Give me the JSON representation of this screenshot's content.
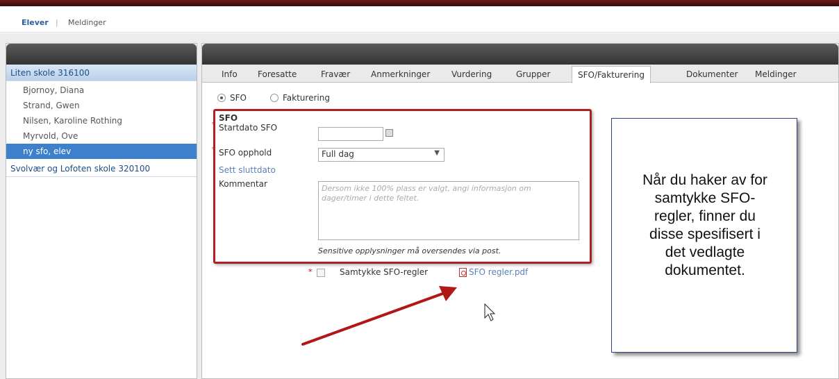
{
  "topnav": {
    "elever": "Elever",
    "separator": "|",
    "meldinger": "Meldinger"
  },
  "left": {
    "schools": [
      {
        "label": "Liten skole 316100",
        "selected": true
      },
      {
        "label": "Svolvær og Lofoten skole 320100",
        "selected": false
      }
    ],
    "students": [
      {
        "label": "Bjornoy, Diana",
        "selected": false
      },
      {
        "label": "Strand, Gwen",
        "selected": false
      },
      {
        "label": "Nilsen, Karoline Rothing",
        "selected": false
      },
      {
        "label": "Myrvold, Ove",
        "selected": false
      },
      {
        "label": "ny sfo, elev",
        "selected": true
      }
    ]
  },
  "tabs": [
    "Info",
    "Foresatte",
    "Fravær",
    "Anmerkninger",
    "Vurdering",
    "Grupper",
    "SFO/Fakturering",
    "Dokumenter",
    "Meldinger"
  ],
  "active_tab": "SFO/Fakturering",
  "radios": {
    "sfo": "SFO",
    "fakturering": "Fakturering",
    "selected": "SFO"
  },
  "form": {
    "section_title": "SFO",
    "required_marker": "*",
    "startdato_label": "Startdato SFO",
    "startdato_value": "",
    "opphold_label": "SFO opphold",
    "opphold_value": "Full dag",
    "sett_sluttdato": "Sett sluttdato",
    "kommentar_label": "Kommentar",
    "kommentar_placeholder": "Dersom ikke 100% plass er valgt, angi informasjon om dager/timer i dette feltet.",
    "sensitive_note": "Sensitive opplysninger må oversendes via post.",
    "samtykke_label": "Samtykke SFO-regler",
    "pdf_link": "SFO regler.pdf"
  },
  "callout": {
    "lines": [
      "Når du haker av for",
      "samtykke SFO-",
      "regler, finner du",
      "disse spesifisert i",
      "det vedlagte",
      "dokumentet."
    ]
  },
  "colors": {
    "accent_red": "#b02020",
    "link_blue": "#2a5d96",
    "selected_blue": "#3d80cc",
    "header_dark": "#3a3a3a"
  },
  "icons": {
    "calendar": "calendar-icon",
    "dropdown": "chevron-down-icon",
    "pdf": "pdf-icon",
    "cursor": "mouse-cursor-icon",
    "arrow": "annotation-arrow"
  }
}
